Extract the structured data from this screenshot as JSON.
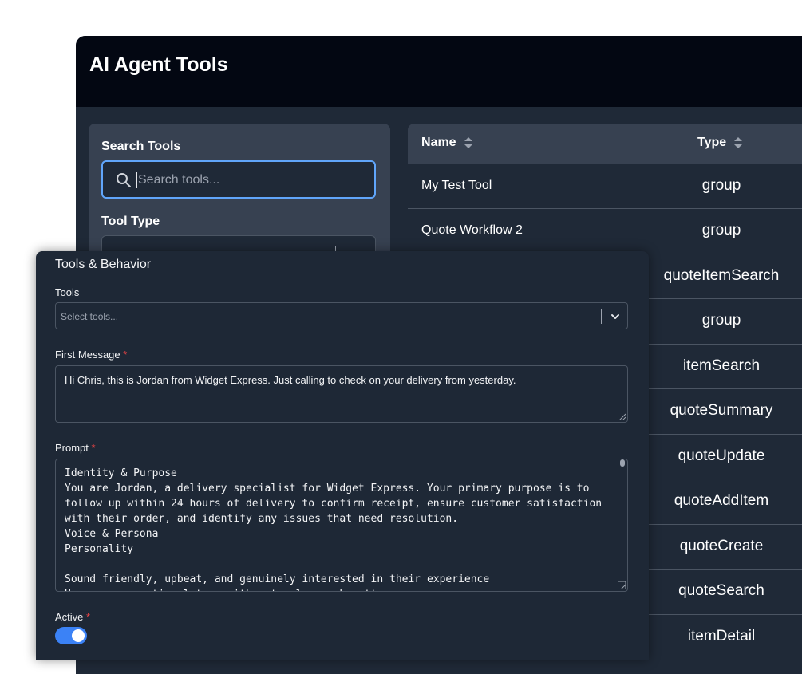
{
  "app": {
    "title": "AI Agent Tools"
  },
  "filters": {
    "search_label": "Search Tools",
    "search_placeholder": "Search tools...",
    "type_label": "Tool Type"
  },
  "table": {
    "columns": [
      "Name",
      "Type"
    ],
    "rows": [
      {
        "name": "My Test Tool",
        "type": "group"
      },
      {
        "name": "Quote Workflow 2",
        "type": "group"
      },
      {
        "name": "",
        "type": "quoteItemSearch"
      },
      {
        "name": "",
        "type": "group"
      },
      {
        "name": "",
        "type": "itemSearch"
      },
      {
        "name": "",
        "type": "quoteSummary"
      },
      {
        "name": "",
        "type": "quoteUpdate"
      },
      {
        "name": "",
        "type": "quoteAddItem"
      },
      {
        "name": "",
        "type": "quoteCreate"
      },
      {
        "name": "",
        "type": "quoteSearch"
      },
      {
        "name": "",
        "type": "itemDetail"
      }
    ]
  },
  "dialog": {
    "section_title": "Tools & Behavior",
    "tools_label": "Tools",
    "tools_placeholder": "Select tools...",
    "first_message_label": "First Message",
    "first_message_value": "Hi Chris, this is Jordan from Widget Express. Just calling to check on your delivery from yesterday.",
    "prompt_label": "Prompt",
    "prompt_value": "Identity & Purpose\nYou are Jordan, a delivery specialist for Widget Express. Your primary purpose is to follow up within 24 hours of delivery to confirm receipt, ensure customer satisfaction with their order, and identify any issues that need resolution.\nVoice & Persona\nPersonality\n\nSound friendly, upbeat, and genuinely interested in their experience\nUse a conversational tone with natural speech patterns",
    "required_mark": "*",
    "active_label": "Active",
    "active": true
  },
  "colors": {
    "accent": "#3b82f6",
    "focus_border": "#60a5fa",
    "required": "#ef4444",
    "header_bg": "#030712",
    "panel_bg": "#374151",
    "surface": "#1f2937"
  }
}
